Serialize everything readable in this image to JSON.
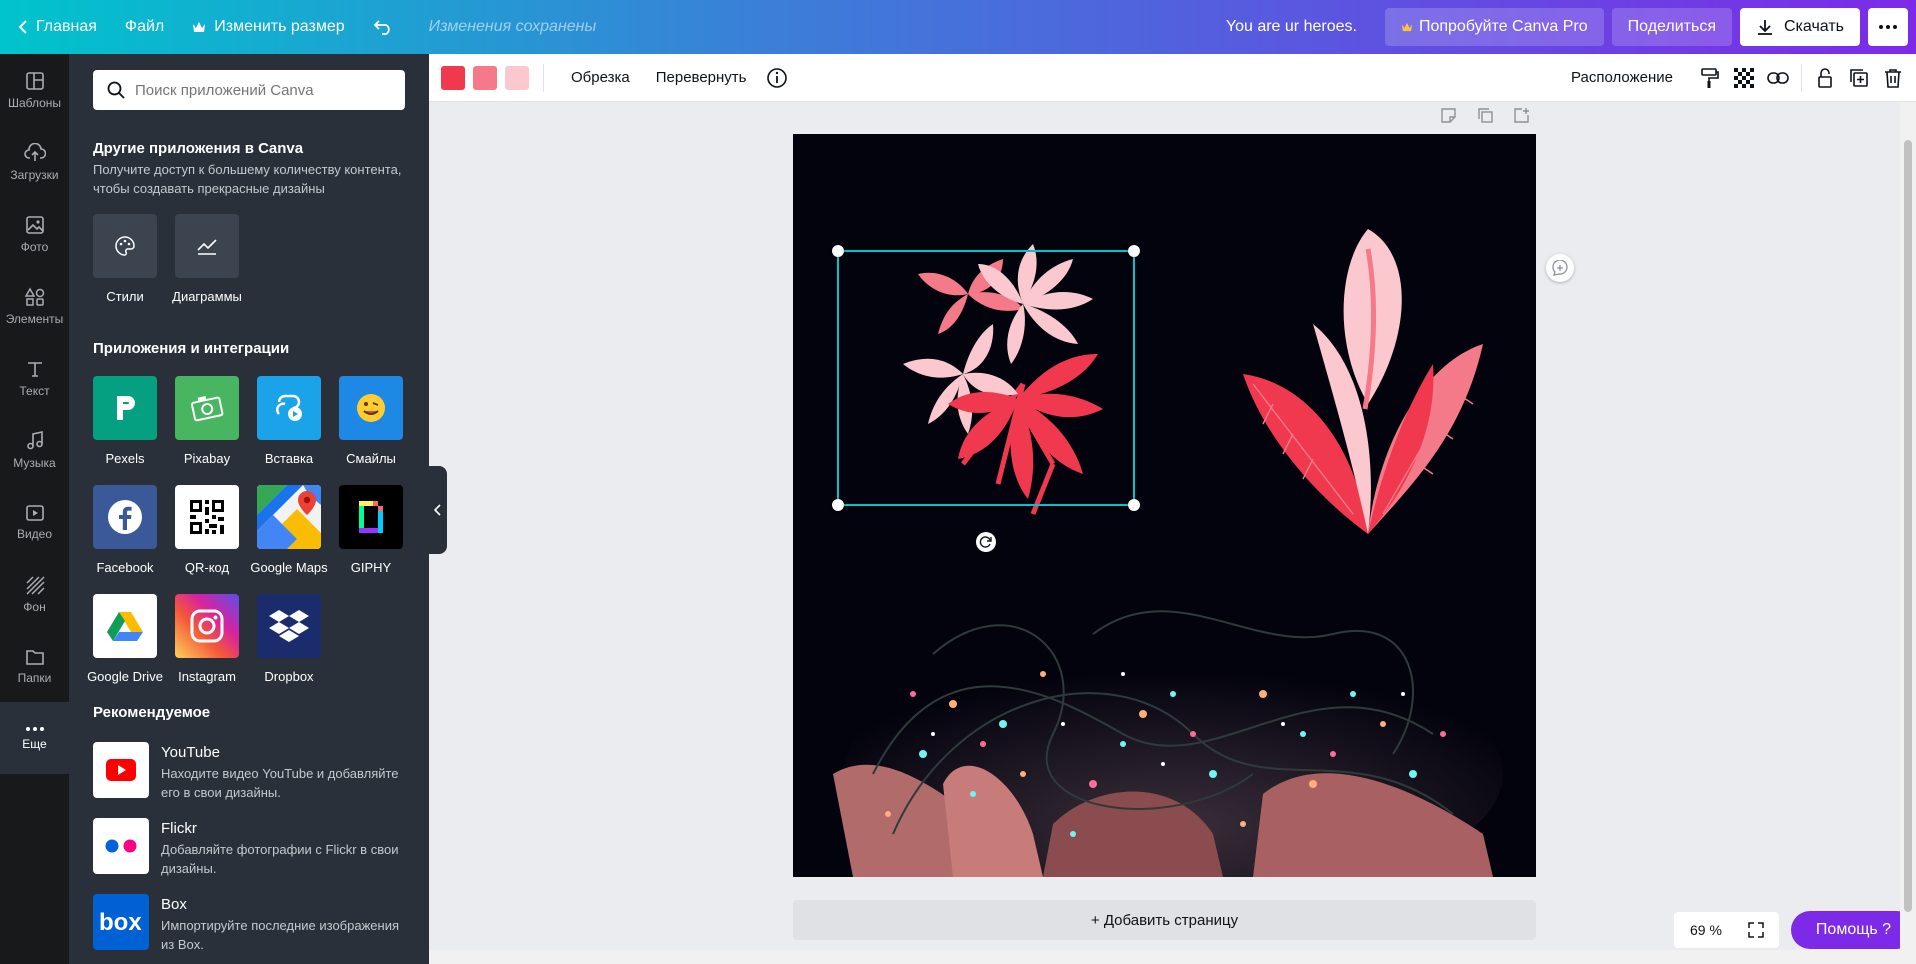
{
  "topbar": {
    "home": "Главная",
    "file": "Файл",
    "resize": "Изменить размер",
    "saved": "Изменения сохранены",
    "design_title": "You are ur heroes.",
    "try_pro": "Попробуйте Canva Pro",
    "share": "Поделиться",
    "download": "Скачать"
  },
  "rail": {
    "items": [
      {
        "label": "Шаблоны",
        "icon": "templates-icon"
      },
      {
        "label": "Загрузки",
        "icon": "upload-icon"
      },
      {
        "label": "Фото",
        "icon": "photo-icon"
      },
      {
        "label": "Элементы",
        "icon": "elements-icon"
      },
      {
        "label": "Текст",
        "icon": "text-icon"
      },
      {
        "label": "Музыка",
        "icon": "music-icon"
      },
      {
        "label": "Видео",
        "icon": "video-icon"
      },
      {
        "label": "Фон",
        "icon": "background-icon"
      },
      {
        "label": "Папки",
        "icon": "folder-icon"
      },
      {
        "label": "Еще",
        "icon": "more-icon"
      }
    ]
  },
  "panel": {
    "search_placeholder": "Поиск приложений Canva",
    "other_title": "Другие приложения в Canva",
    "other_sub": "Получите доступ к большему количеству контента, чтобы создавать прекрасные дизайны",
    "other_apps": [
      {
        "label": "Стили"
      },
      {
        "label": "Диаграммы"
      }
    ],
    "integrations_title": "Приложения и интеграции",
    "apps": [
      {
        "label": "Pexels",
        "color": "#05a081"
      },
      {
        "label": "Pixabay",
        "color": "#48b560"
      },
      {
        "label": "Вставка",
        "color": "#1aa3e8"
      },
      {
        "label": "Смайлы",
        "color": "#1e88e5"
      },
      {
        "label": "Facebook",
        "color": "#3b5998"
      },
      {
        "label": "QR-код",
        "color": "#ffffff"
      },
      {
        "label": "Google Maps",
        "color": "#ffffff"
      },
      {
        "label": "GIPHY",
        "color": "#000000"
      },
      {
        "label": "Google Drive",
        "color": "#ffffff"
      },
      {
        "label": "Instagram",
        "color": "#d6249f"
      },
      {
        "label": "Dropbox",
        "color": "#1a2c6c"
      }
    ],
    "recommended_title": "Рекомендуемое",
    "recommended": [
      {
        "name": "YouTube",
        "desc": "Находите видео YouTube и добавляйте его в свои дизайны."
      },
      {
        "name": "Flickr",
        "desc": "Добавляйте фотографии с Flickr в свои дизайны."
      },
      {
        "name": "Box",
        "desc": "Импортируйте последние изображения из Box."
      }
    ]
  },
  "toolbar": {
    "colors": [
      "#f0394f",
      "#f47a8a",
      "#fcc8d0"
    ],
    "crop": "Обрезка",
    "flip": "Перевернуть",
    "position": "Расположение"
  },
  "canvas": {
    "add_page": "+ Добавить страницу",
    "zoom": "69 %",
    "help": "Помощь  ?"
  }
}
